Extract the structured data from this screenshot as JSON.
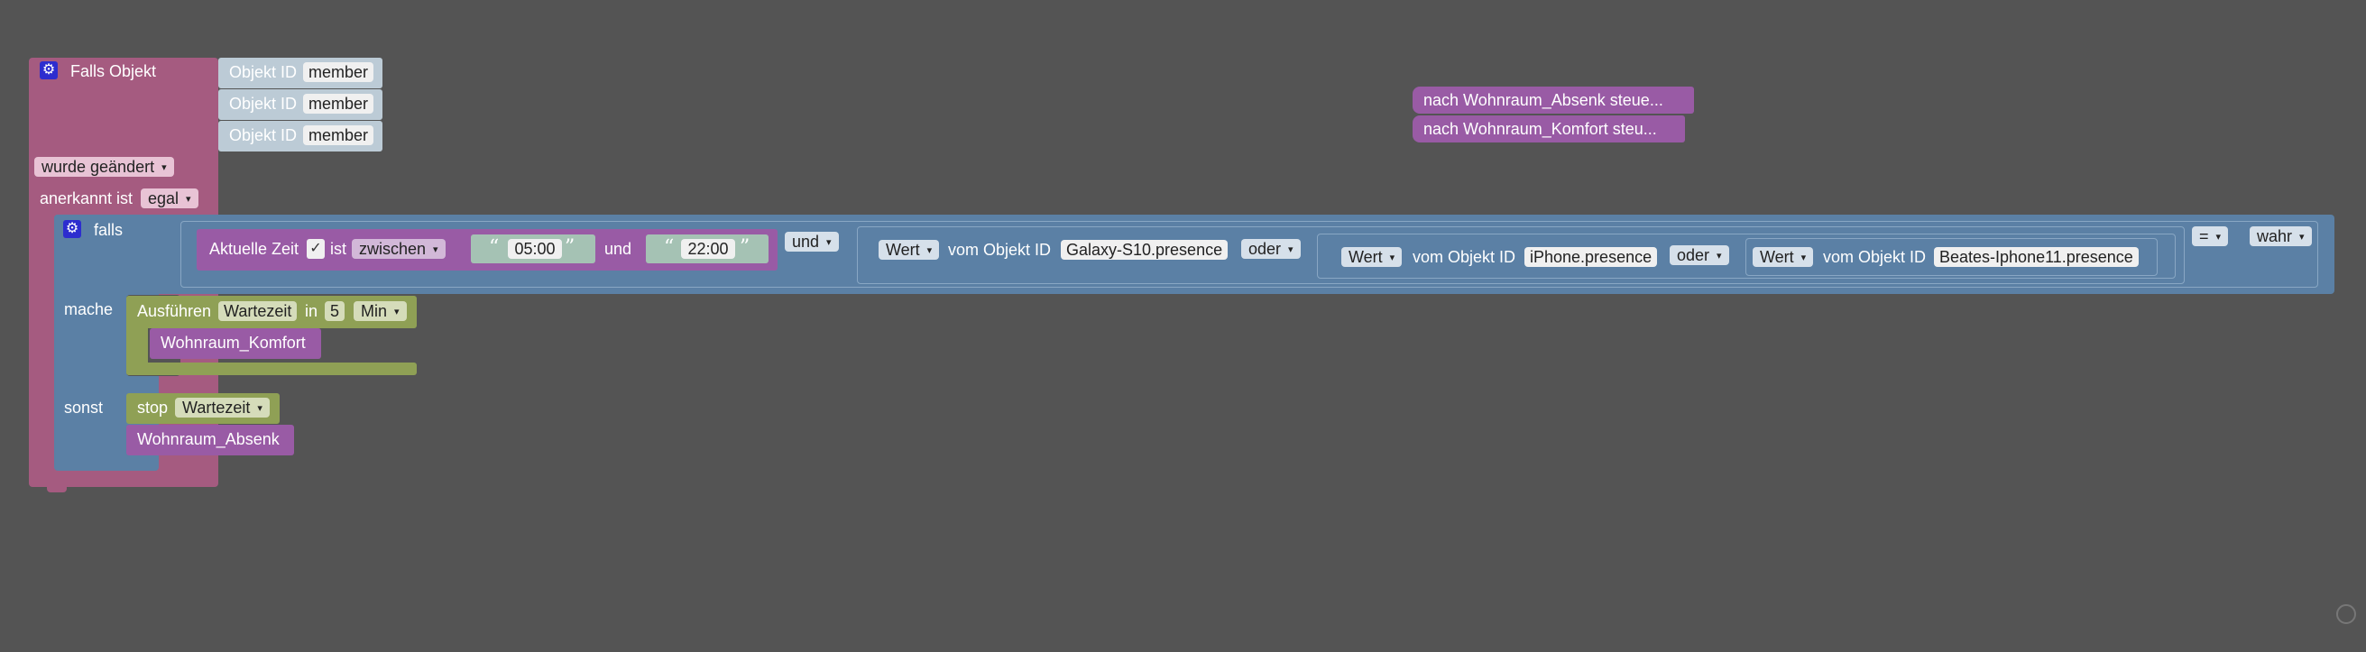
{
  "colors": {
    "background": "#545454",
    "trigger_block": "#a55b80",
    "id_block": "#bccbd6",
    "logic_block": "#5b80a5",
    "time_block": "#995ba5",
    "timeout_block": "#8fa055",
    "text_block": "#a5c2b4"
  },
  "trigger": {
    "title": "Falls Objekt",
    "object_id_label": "Objekt ID",
    "ids": [
      "member",
      "member",
      "member"
    ],
    "changed_option": "wurde geändert",
    "ack_label": "anerkannt ist",
    "ack_option": "egal"
  },
  "if_block": {
    "if_label": "falls",
    "do_label": "mache",
    "else_label": "sonst",
    "current_time_label": "Aktuelle Zeit",
    "current_time_is": "ist",
    "between_option": "zwischen",
    "start_time": "05:00",
    "and_text": "und",
    "end_time": "22:00",
    "logic_and": "und",
    "value_option": "Wert",
    "of_object_label": "vom Objekt ID",
    "object_1": "Galaxy-S10.presence",
    "logic_or": "oder",
    "object_2": "iPhone.presence",
    "object_3": "Beates-Iphone11.presence",
    "compare_op": "=",
    "compare_value": "wahr"
  },
  "do_branch": {
    "execute_label": "Ausführen",
    "timer_name": "Wartezeit",
    "in_label": "in",
    "delay": "5",
    "unit": "Min",
    "call_label": "Wohnraum_Komfort"
  },
  "else_branch": {
    "stop_label": "stop",
    "timer_name": "Wartezeit",
    "call_label": "Wohnraum_Absenk"
  },
  "functions": {
    "absenk": "nach Wohnraum_Absenk  steue...",
    "komfort": "nach Wohnraum_Komfort  steu..."
  }
}
